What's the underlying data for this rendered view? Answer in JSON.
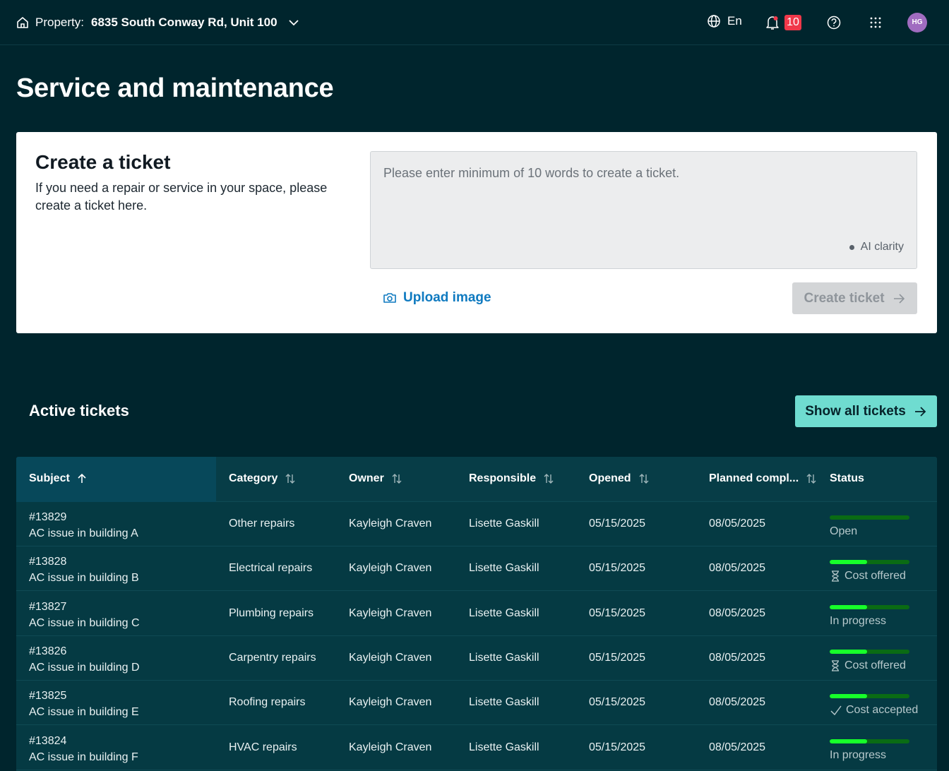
{
  "topbar": {
    "property_label": "Property:",
    "property_address": "6835 South Conway Rd, Unit 100",
    "language": "En",
    "notifications_count": "10",
    "avatar_initials": "HG"
  },
  "page_title": "Service and maintenance",
  "create_ticket": {
    "title": "Create a ticket",
    "description": "If you need a repair or service in your space, please create a ticket here.",
    "placeholder": "Please enter minimum of 10 words to create a ticket.",
    "ai_label": "AI clarity",
    "upload_label": "Upload image",
    "create_label": "Create ticket"
  },
  "active": {
    "title": "Active tickets",
    "show_all_label": "Show all tickets"
  },
  "colors": {
    "background": "#00252d",
    "accent_teal": "#6fdcd0",
    "link_blue": "#0f7ac0",
    "badge_red": "#f0384a",
    "progress_green": "#17ff2a"
  },
  "table": {
    "headers": {
      "subject": "Subject",
      "category": "Category",
      "owner": "Owner",
      "responsible": "Responsible",
      "opened": "Opened",
      "planned": "Planned compl...",
      "status": "Status"
    },
    "rows": [
      {
        "id": "#13829",
        "subject": "AC issue in building A",
        "category": "Other repairs",
        "owner": "Kayleigh Craven",
        "responsible": "Lisette Gaskill",
        "opened": "05/15/2025",
        "planned": "08/05/2025",
        "status": "Open",
        "status_icon": "",
        "progress": 0
      },
      {
        "id": "#13828",
        "subject": "AC issue in building B",
        "category": "Electrical repairs",
        "owner": "Kayleigh Craven",
        "responsible": "Lisette Gaskill",
        "opened": "05/15/2025",
        "planned": "08/05/2025",
        "status": "Cost offered",
        "status_icon": "hourglass-icon",
        "progress": 0.47
      },
      {
        "id": "#13827",
        "subject": "AC issue in building C",
        "category": "Plumbing repairs",
        "owner": "Kayleigh Craven",
        "responsible": "Lisette Gaskill",
        "opened": "05/15/2025",
        "planned": "08/05/2025",
        "status": "In progress",
        "status_icon": "",
        "progress": 0.47
      },
      {
        "id": "#13826",
        "subject": "AC issue in building D",
        "category": "Carpentry repairs",
        "owner": "Kayleigh Craven",
        "responsible": "Lisette Gaskill",
        "opened": "05/15/2025",
        "planned": "08/05/2025",
        "status": "Cost offered",
        "status_icon": "hourglass-icon",
        "progress": 0.47
      },
      {
        "id": "#13825",
        "subject": "AC issue in building E",
        "category": "Roofing repairs",
        "owner": "Kayleigh Craven",
        "responsible": "Lisette Gaskill",
        "opened": "05/15/2025",
        "planned": "08/05/2025",
        "status": "Cost accepted",
        "status_icon": "check-icon",
        "progress": 0.47
      },
      {
        "id": "#13824",
        "subject": "AC issue in building F",
        "category": "HVAC repairs",
        "owner": "Kayleigh Craven",
        "responsible": "Lisette Gaskill",
        "opened": "05/15/2025",
        "planned": "08/05/2025",
        "status": "In progress",
        "status_icon": "",
        "progress": 0.47
      }
    ]
  }
}
